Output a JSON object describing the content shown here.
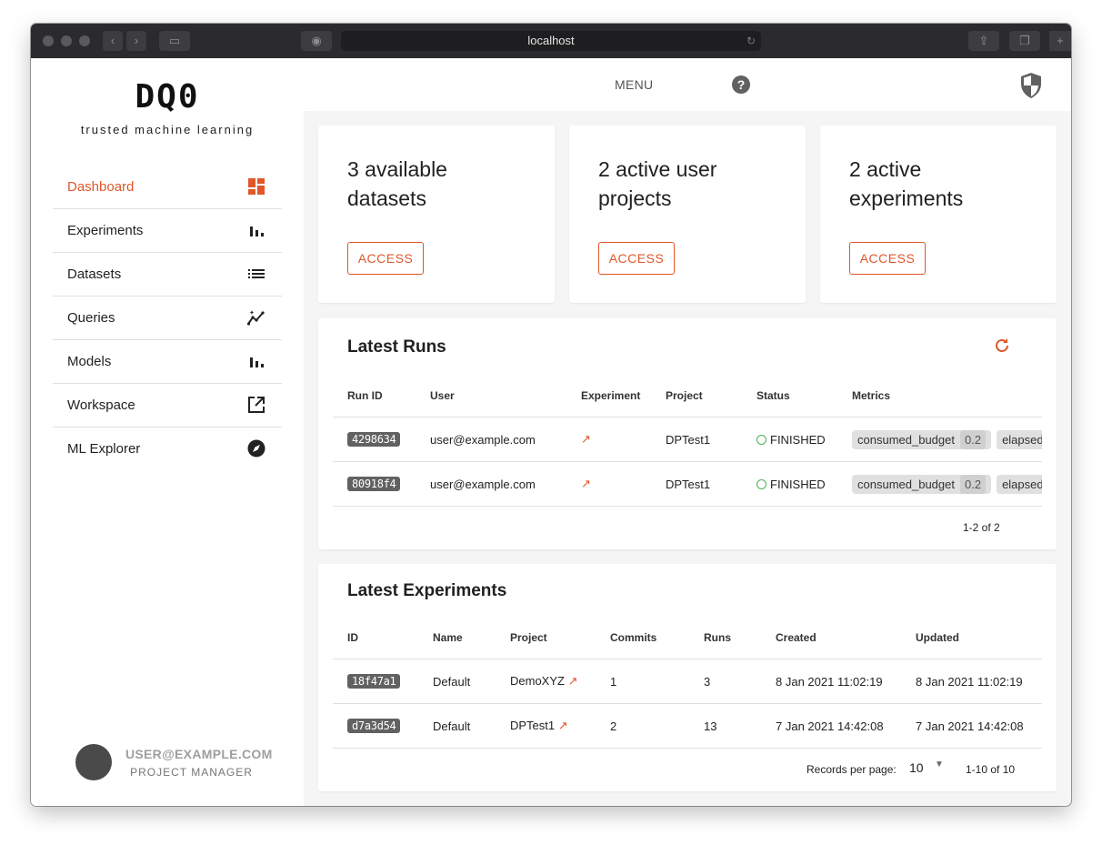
{
  "browser": {
    "url": "localhost"
  },
  "app": {
    "logo": "DQ0",
    "tagline": "trusted machine learning"
  },
  "header": {
    "menu_label": "MENU",
    "help_symbol": "?"
  },
  "sidebar": {
    "items": [
      {
        "label": "Dashboard",
        "icon": "dashboard-icon",
        "active": true
      },
      {
        "label": "Experiments",
        "icon": "bar-chart-icon"
      },
      {
        "label": "Datasets",
        "icon": "list-icon"
      },
      {
        "label": "Queries",
        "icon": "insights-icon"
      },
      {
        "label": "Models",
        "icon": "bar-chart-icon"
      },
      {
        "label": "Workspace",
        "icon": "open-in-new-icon"
      },
      {
        "label": "ML Explorer",
        "icon": "compass-icon"
      }
    ],
    "user": {
      "email": "USER@EXAMPLE.COM",
      "role": "PROJECT MANAGER"
    }
  },
  "stats": [
    {
      "title": "3 available datasets",
      "button": "ACCESS"
    },
    {
      "title": "2 active user projects",
      "button": "ACCESS"
    },
    {
      "title": "2 active experiments",
      "button": "ACCESS"
    }
  ],
  "runs": {
    "title": "Latest Runs",
    "columns": [
      "Run ID",
      "User",
      "Experiment",
      "Project",
      "Status",
      "Metrics"
    ],
    "rows": [
      {
        "id": "4298634",
        "user": "user@example.com",
        "project": "DPTest1",
        "status": "FINISHED",
        "metric_name": "consumed_budget",
        "metric_value": "0.2",
        "metric2": "elapsed"
      },
      {
        "id": "80918f4",
        "user": "user@example.com",
        "project": "DPTest1",
        "status": "FINISHED",
        "metric_name": "consumed_budget",
        "metric_value": "0.2",
        "metric2": "elapsed"
      }
    ],
    "pagination": "1-2 of 2"
  },
  "experiments": {
    "title": "Latest Experiments",
    "columns": [
      "ID",
      "Name",
      "Project",
      "Commits",
      "Runs",
      "Created",
      "Updated"
    ],
    "rows": [
      {
        "id": "18f47a1",
        "name": "Default",
        "project": "DemoXYZ",
        "commits": "1",
        "runs": "3",
        "created": "8 Jan 2021 11:02:19",
        "updated": "8 Jan 2021 11:02:19"
      },
      {
        "id": "d7a3d54",
        "name": "Default",
        "project": "DPTest1",
        "commits": "2",
        "runs": "13",
        "created": "7 Jan 2021 14:42:08",
        "updated": "7 Jan 2021 14:42:08"
      }
    ],
    "records_per_page_label": "Records per page:",
    "records_per_page": "10",
    "pagination": "1-10 of 10"
  },
  "colors": {
    "accent": "#e0572a",
    "sidebar_bg": "#ffffff",
    "content_bg": "#f5f5f5"
  }
}
